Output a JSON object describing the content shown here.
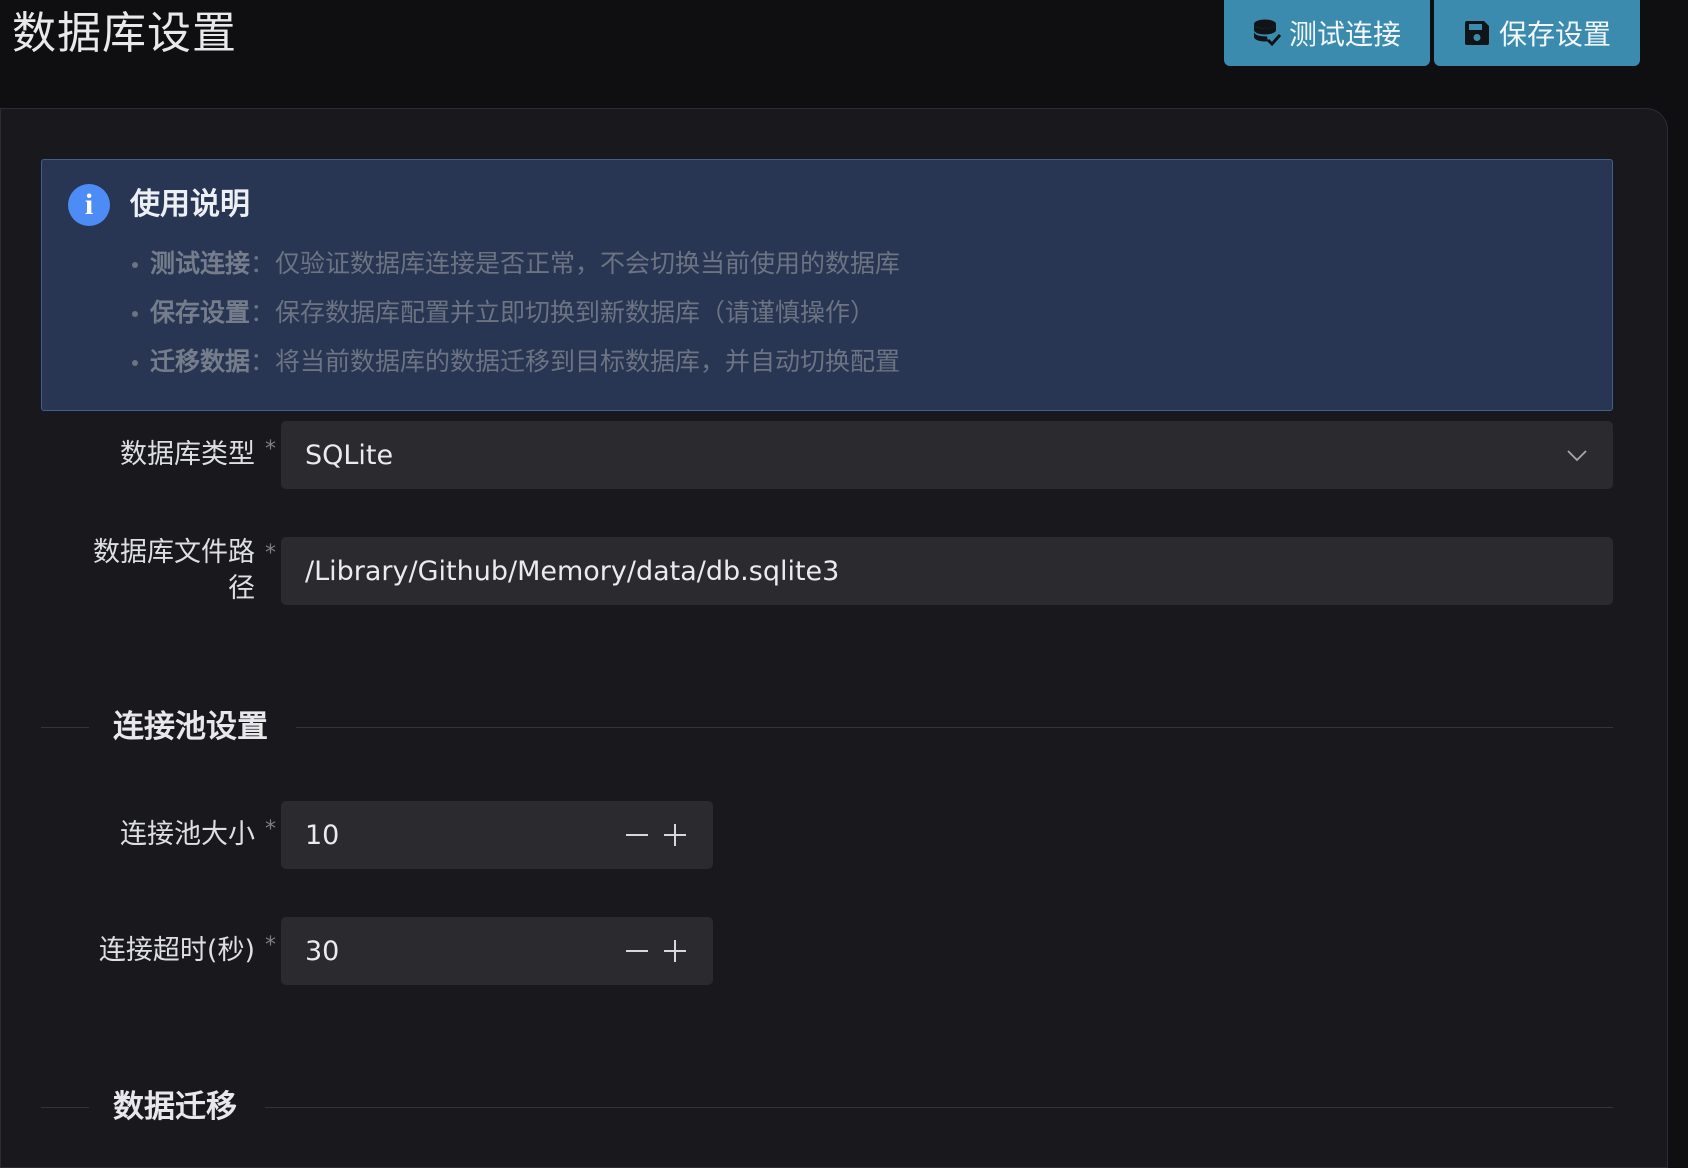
{
  "header": {
    "title": "数据库设置",
    "test_button_label": "测试连接",
    "save_button_label": "保存设置"
  },
  "alert": {
    "title": "使用说明",
    "items": [
      {
        "term": "测试连接",
        "desc": "仅验证数据库连接是否正常，不会切换当前使用的数据库"
      },
      {
        "term": "保存设置",
        "desc": "保存数据库配置并立即切换到新数据库（请谨慎操作）"
      },
      {
        "term": "迁移数据",
        "desc": "将当前数据库的数据迁移到目标数据库，并自动切换配置"
      }
    ]
  },
  "form": {
    "db_type": {
      "label": "数据库类型",
      "value": "SQLite"
    },
    "db_path": {
      "label_line1": "数据库文件路",
      "label_line2": "径",
      "value": "/Library/Github/Memory/data/db.sqlite3"
    },
    "pool_size": {
      "label": "连接池大小",
      "value": "10"
    },
    "timeout": {
      "label": "连接超时(秒)",
      "value": "30"
    },
    "required_mark": "*"
  },
  "sections": {
    "pool": "连接池设置",
    "migration": "数据迁移"
  },
  "colors": {
    "accent_button": "#3a8bae",
    "info_icon": "#4e8cf5",
    "alert_bg": "#283653"
  }
}
